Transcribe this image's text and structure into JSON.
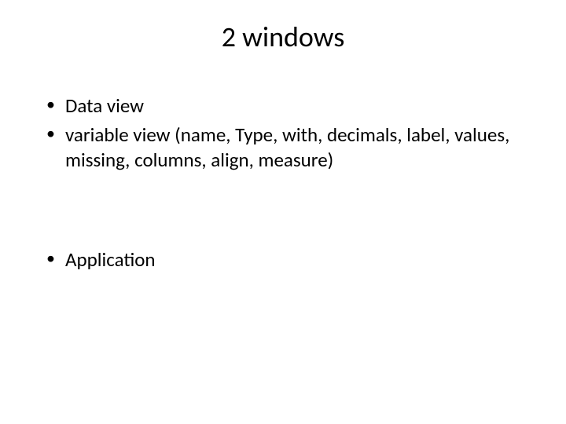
{
  "title": "2 windows",
  "bullets": {
    "item1": "Data view",
    "item2": "variable view (name, Type, with, decimals, label, values, missing, columns, align, measure)",
    "item3": "Application"
  }
}
